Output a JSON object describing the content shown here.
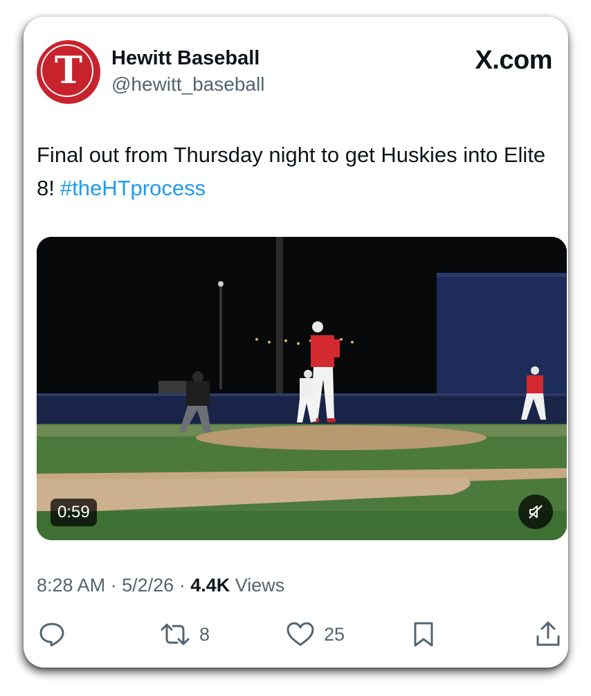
{
  "post": {
    "display_name": "Hewitt Baseball",
    "handle": "@hewitt_baseball",
    "avatar_letter": "T",
    "site_label": "X.com",
    "text": "Final out from Thursday night to get Huskies into Elite 8!",
    "hashtag": "#theHTprocess",
    "media": {
      "duration": "0:59",
      "muted": true
    },
    "meta": {
      "time": "8:28 AM",
      "separator": "·",
      "date": "5/2/26",
      "views_count": "4.4K",
      "views_label": "Views"
    },
    "actions": {
      "reply": {
        "icon": "reply-icon"
      },
      "repost": {
        "icon": "repost-icon",
        "count": "8"
      },
      "like": {
        "icon": "heart-icon",
        "count": "25"
      },
      "bookmark": {
        "icon": "bookmark-icon"
      },
      "share": {
        "icon": "share-icon"
      }
    }
  },
  "colors": {
    "brand_red": "#c8232c",
    "link_blue": "#1d9bf0",
    "text_primary": "#0f1419",
    "text_secondary": "#536471"
  }
}
